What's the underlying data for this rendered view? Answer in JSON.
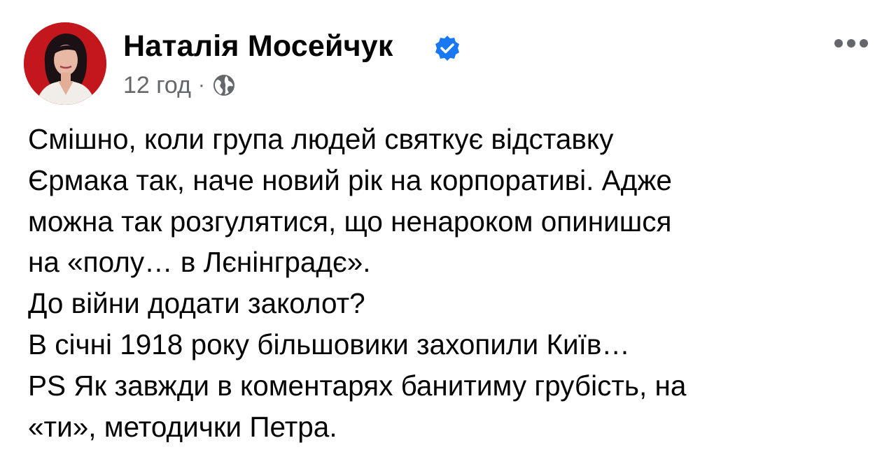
{
  "post": {
    "author": "Наталія Мосейчук",
    "time": "12 год",
    "separator": "·",
    "lines": [
      "Смішно, коли група людей святкує відставку",
      "Єрмака так, наче новий рік на корпоративі. Адже",
      "можна так розгулятися, що ненароком опинишся",
      "на «полу… в Лєнінградє».",
      "До війни додати  заколот?",
      "В січні  1918 року більшовики захопили Київ…",
      "PS Як завжди в коментарях банитиму грубість, на",
      "«ти», методички Петра."
    ]
  },
  "icons": {
    "avatar": "avatar",
    "verified": "verified-badge-icon",
    "audience": "globe-icon",
    "menu": "more-options-icon"
  },
  "colors": {
    "verified_badge": "#1877f2",
    "meta_text": "#65676b",
    "avatar_background": "#c4171d",
    "body_text": "#050505"
  }
}
